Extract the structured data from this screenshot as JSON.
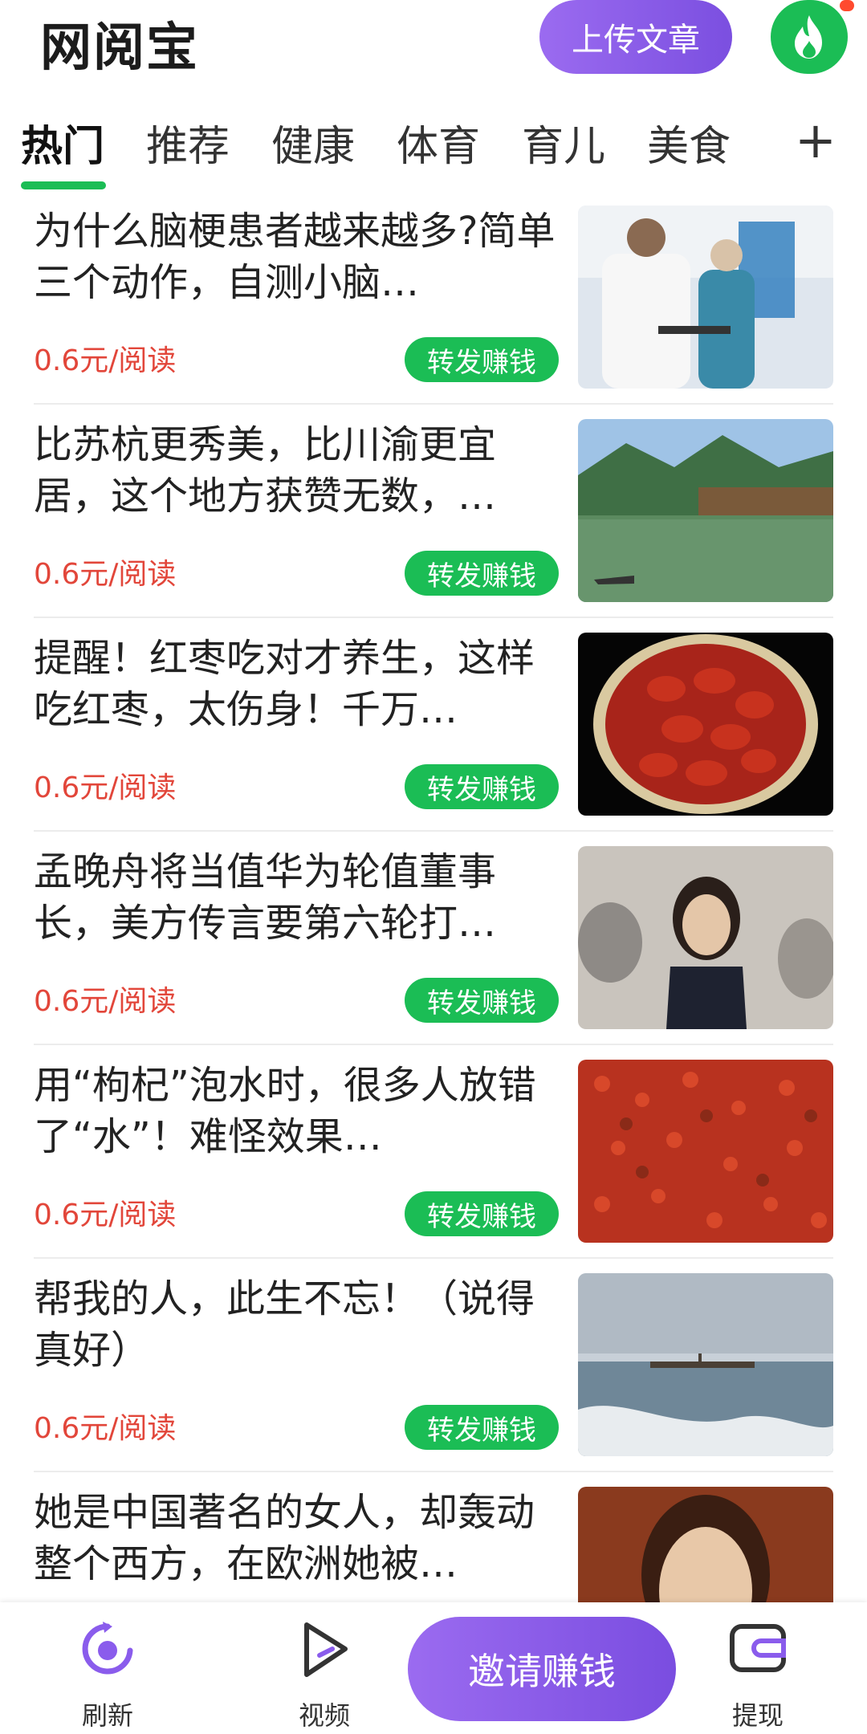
{
  "header": {
    "app_title": "网阅宝",
    "upload_label": "上传文章"
  },
  "tabs": [
    {
      "label": "热门",
      "active": true
    },
    {
      "label": "推荐"
    },
    {
      "label": "健康"
    },
    {
      "label": "体育"
    },
    {
      "label": "育儿"
    },
    {
      "label": "美食"
    }
  ],
  "tab_add": "+",
  "articles": [
    {
      "title": "为什么脑梗患者越来越多?简单三个动作，自测小脑…",
      "price": "0.6元/阅读",
      "share": "转发赚钱",
      "thumb": "doctor-clinic"
    },
    {
      "title": "比苏杭更秀美，比川渝更宜居，这个地方获赞无数，…",
      "price": "0.6元/阅读",
      "share": "转发赚钱",
      "thumb": "river-town"
    },
    {
      "title": "提醒！红枣吃对才养生，这样吃红枣，太伤身！千万…",
      "price": "0.6元/阅读",
      "share": "转发赚钱",
      "thumb": "red-dates"
    },
    {
      "title": "孟晚舟将当值华为轮值董事长，美方传言要第六轮打…",
      "price": "0.6元/阅读",
      "share": "转发赚钱",
      "thumb": "woman-portrait"
    },
    {
      "title": "用“枸杞”泡水时，很多人放错了“水”！难怪效果…",
      "price": "0.6元/阅读",
      "share": "转发赚钱",
      "thumb": "goji-berries"
    },
    {
      "title": "帮我的人，此生不忘！（说得真好）",
      "price": "0.6元/阅读",
      "share": "转发赚钱",
      "thumb": "seaside-pier"
    },
    {
      "title": "她是中国著名的女人，却轰动整个西方，在欧洲她被…",
      "price": "",
      "share": "",
      "thumb": "actress-face"
    }
  ],
  "bottom_nav": {
    "refresh": "刷新",
    "video": "视频",
    "invite": "邀请赚钱",
    "withdraw": "提现"
  },
  "colors": {
    "accent_green": "#1bbd55",
    "accent_purple": "#8a5cec",
    "price_red": "#e2463a"
  }
}
